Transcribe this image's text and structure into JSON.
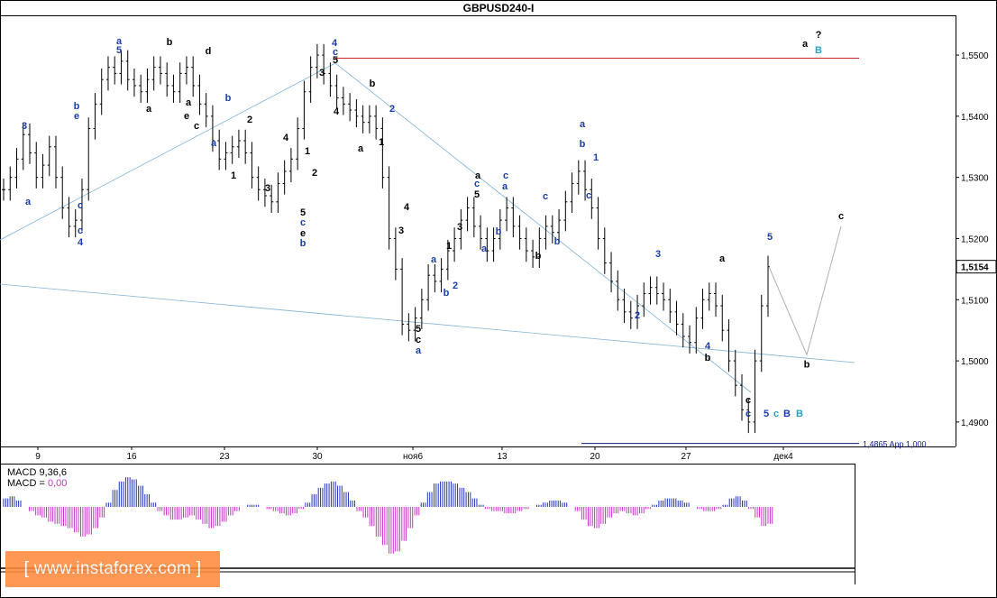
{
  "window": {
    "title": "GBPUSD240-I"
  },
  "chart_data": {
    "type": "line",
    "title": "GBPUSD240-I",
    "y_ticks": [
      "1,5500",
      "1,5400",
      "1,5300",
      "1,5200",
      "1,5100",
      "1,5000",
      "1,4900"
    ],
    "ylim": [
      1.486,
      1.5565
    ],
    "current_price": "1,5154",
    "x_ticks": [
      "9",
      "16",
      "23",
      "30",
      "ноя6",
      "13",
      "20",
      "27",
      "дек4"
    ],
    "series": [
      {
        "values": [
          1.528,
          1.53,
          1.533,
          1.537,
          1.534,
          1.53,
          1.532,
          1.535,
          1.53,
          1.525,
          1.522,
          1.523,
          1.528,
          1.538,
          1.542,
          1.546,
          1.548,
          1.547,
          1.549,
          1.546,
          1.545,
          1.544,
          1.546,
          1.548,
          1.547,
          1.545,
          1.544,
          1.547,
          1.548,
          1.545,
          1.542,
          1.54,
          1.536,
          1.533,
          1.534,
          1.535,
          1.536,
          1.534,
          1.53,
          1.528,
          1.527,
          1.526,
          1.529,
          1.531,
          1.533,
          1.538,
          1.544,
          1.548,
          1.55,
          1.547,
          1.545,
          1.543,
          1.542,
          1.541,
          1.54,
          1.539,
          1.54,
          1.538,
          1.53,
          1.52,
          1.515,
          1.506,
          1.505,
          1.507,
          1.51,
          1.514,
          1.513,
          1.515,
          1.518,
          1.52,
          1.523,
          1.525,
          1.522,
          1.52,
          1.518,
          1.52,
          1.523,
          1.525,
          1.522,
          1.52,
          1.518,
          1.517,
          1.52,
          1.522,
          1.521,
          1.523,
          1.526,
          1.529,
          1.531,
          1.528,
          1.525,
          1.52,
          1.516,
          1.513,
          1.51,
          1.508,
          1.507,
          1.509,
          1.511,
          1.512,
          1.511,
          1.51,
          1.508,
          1.506,
          1.504,
          1.503,
          1.507,
          1.51,
          1.511,
          1.509,
          1.505,
          1.5,
          1.496,
          1.492,
          1.49,
          1.5,
          1.509,
          1.5154
        ]
      }
    ],
    "levels": [
      {
        "value": 1.5495,
        "color": "#cc2222"
      },
      {
        "value": 1.4865,
        "color": "#0a1a8a",
        "label": "1,4865 App 1,000"
      }
    ],
    "projection": {
      "x": [
        0,
        1,
        2
      ],
      "y": [
        1.5154,
        1.501,
        1.522
      ],
      "labels": [
        "b",
        "c"
      ]
    },
    "wave_labels": [
      {
        "text": "3",
        "color": "#1a3ea8"
      },
      {
        "text": "b",
        "color": "#1a3ea8"
      },
      {
        "text": "e",
        "color": "#1a3ea8"
      },
      {
        "text": "c",
        "color": "#1a3ea8"
      },
      {
        "text": "a",
        "color": "#1a3ea8"
      },
      {
        "text": "c",
        "color": "#1a3ea8"
      },
      {
        "text": "4",
        "color": "#1a3ea8"
      },
      {
        "text": "a",
        "color": "#1a3ea8"
      },
      {
        "text": "5",
        "color": "#1a3ea8"
      },
      {
        "text": "a",
        "color": "#000"
      },
      {
        "text": "b",
        "color": "#000"
      },
      {
        "text": "d",
        "color": "#000"
      },
      {
        "text": "c",
        "color": "#000"
      },
      {
        "text": "e",
        "color": "#000"
      },
      {
        "text": "a",
        "color": "#000"
      },
      {
        "text": "b",
        "color": "#1a3ea8"
      },
      {
        "text": "a",
        "color": "#1a3ea8"
      },
      {
        "text": "1",
        "color": "#000"
      },
      {
        "text": "2",
        "color": "#000"
      },
      {
        "text": "3",
        "color": "#000"
      },
      {
        "text": "4",
        "color": "#000"
      },
      {
        "text": "5",
        "color": "#000"
      },
      {
        "text": "c",
        "color": "#1a3ea8"
      },
      {
        "text": "e",
        "color": "#000"
      },
      {
        "text": "b",
        "color": "#1a3ea8"
      },
      {
        "text": "1",
        "color": "#000"
      },
      {
        "text": "2",
        "color": "#000"
      },
      {
        "text": "3",
        "color": "#000"
      },
      {
        "text": "4",
        "color": "#1a3ea8"
      },
      {
        "text": "c",
        "color": "#1a3ea8"
      },
      {
        "text": "5",
        "color": "#000"
      },
      {
        "text": "4",
        "color": "#000"
      },
      {
        "text": "a",
        "color": "#000"
      },
      {
        "text": "b",
        "color": "#000"
      },
      {
        "text": "2",
        "color": "#1a3ea8"
      },
      {
        "text": "1",
        "color": "#000"
      },
      {
        "text": "3",
        "color": "#000"
      },
      {
        "text": "4",
        "color": "#000"
      },
      {
        "text": "5",
        "color": "#000"
      },
      {
        "text": "c",
        "color": "#000"
      },
      {
        "text": "a",
        "color": "#1a3ea8"
      },
      {
        "text": "a",
        "color": "#1a3ea8"
      },
      {
        "text": "b",
        "color": "#1a3ea8"
      },
      {
        "text": "1",
        "color": "#000"
      },
      {
        "text": "2",
        "color": "#1a3ea8"
      },
      {
        "text": "3",
        "color": "#000"
      },
      {
        "text": "a",
        "color": "#000"
      },
      {
        "text": "c",
        "color": "#1a3ea8"
      },
      {
        "text": "5",
        "color": "#000"
      },
      {
        "text": "a",
        "color": "#1a3ea8"
      },
      {
        "text": "b",
        "color": "#1a3ea8"
      },
      {
        "text": "c",
        "color": "#1a3ea8"
      },
      {
        "text": "a",
        "color": "#1a3ea8"
      },
      {
        "text": "c",
        "color": "#1a3ea8"
      },
      {
        "text": "b",
        "color": "#000"
      },
      {
        "text": "b",
        "color": "#1a3ea8"
      },
      {
        "text": "a",
        "color": "#1a3ea8"
      },
      {
        "text": "b",
        "color": "#1a3ea8"
      },
      {
        "text": "c",
        "color": "#1a3ea8"
      },
      {
        "text": "1",
        "color": "#1a3ea8"
      },
      {
        "text": "2",
        "color": "#1a3ea8"
      },
      {
        "text": "3",
        "color": "#1a3ea8"
      },
      {
        "text": "4",
        "color": "#1a3ea8"
      },
      {
        "text": "5",
        "color": "#1a3ea8"
      },
      {
        "text": "a",
        "color": "#000"
      },
      {
        "text": "b",
        "color": "#000"
      },
      {
        "text": "c",
        "color": "#000"
      },
      {
        "text": "c",
        "color": "#1a3ea8"
      },
      {
        "text": "5",
        "color": "#1a3ea8"
      },
      {
        "text": "c",
        "color": "#2aa0c0"
      },
      {
        "text": "B",
        "color": "#1a3ea8"
      },
      {
        "text": "B",
        "color": "#2aa0c0"
      },
      {
        "text": "a",
        "color": "#000"
      },
      {
        "text": "?",
        "color": "#000"
      },
      {
        "text": "B",
        "color": "#2aa0c0"
      },
      {
        "text": "C",
        "color": "#1a3ea8"
      }
    ]
  },
  "indicator": {
    "label_macd": "MACD 9,36,6",
    "label_macd2_prefix": "MACD = ",
    "label_macd2_value": "0,00",
    "histogram": [
      4,
      5,
      3,
      0,
      -2,
      -4,
      -5,
      -7,
      -8,
      -9,
      -10,
      -12,
      -14,
      -13,
      -10,
      -5,
      2,
      8,
      12,
      14,
      13,
      10,
      6,
      2,
      -2,
      -4,
      -6,
      -6,
      -5,
      -4,
      -6,
      -8,
      -10,
      -9,
      -7,
      -4,
      -2,
      0,
      1,
      1,
      0,
      -1,
      -2,
      -3,
      -4,
      -3,
      -1,
      2,
      6,
      9,
      11,
      12,
      10,
      7,
      3,
      -2,
      -5,
      -9,
      -14,
      -18,
      -22,
      -21,
      -16,
      -10,
      -4,
      2,
      7,
      11,
      12,
      12,
      11,
      9,
      7,
      4,
      1,
      -1,
      -2,
      -2,
      -3,
      -3,
      -2,
      -1,
      0,
      1,
      2,
      3,
      3,
      2,
      0,
      -2,
      -6,
      -9,
      -10,
      -8,
      -5,
      -3,
      -2,
      -3,
      -4,
      -3,
      -1,
      1,
      3,
      4,
      4,
      3,
      2,
      0,
      -1,
      -2,
      -2,
      -1,
      1,
      4,
      5,
      3,
      -1,
      -5,
      -9,
      -8
    ],
    "colors": {
      "positive": "#2233bb",
      "negative": "#cc33cc"
    }
  },
  "watermark": {
    "text": "[ www.instaforex.com ]"
  }
}
